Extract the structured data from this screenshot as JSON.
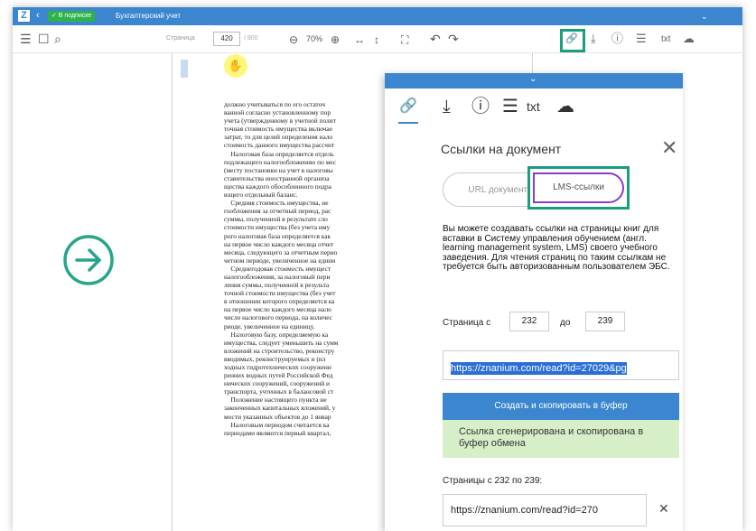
{
  "colors": {
    "brand_blue": "#3b86cf",
    "badge_green": "#2fb24c",
    "highlight_teal": "#1a9e7f",
    "lms_tab_border": "#8a3cc8",
    "success_bg": "#d7efc9",
    "selection_blue": "#2b6fd6"
  },
  "titlebar": {
    "logo": "Z",
    "back_icon": "chevron-left-icon",
    "badge": "✓ В подписке",
    "title": "Бухгалтерский учет",
    "menu_icon": "chevron-down-icon"
  },
  "toolbar": {
    "menu_icon": "☰",
    "bookmark_icon": "☐",
    "search_icon": "⌕",
    "page_label": "Страница",
    "page_value": "420",
    "page_total": "/ 900",
    "zoom_out": "⊖",
    "zoom_value": "70%",
    "zoom_in": "⊕",
    "fit_width": "↔",
    "fit_height": "↕",
    "fullscreen": "⛶",
    "undo": "↶",
    "redo": "↷",
    "link_icon": "🔗",
    "download_icon": "⤓",
    "info_icon": "ⓘ",
    "print_icon": "☰",
    "txt_label": "txt",
    "cloud_icon": "☁"
  },
  "document": {
    "lines": [
      "должно учитываться по его остаточ",
      "ванной согласно установленному пор",
      "учета (утвержденному в учетной полит",
      "точная стоимость имущества включае",
      "затрат, то для целей определения нало",
      "стоимость данного имущества рассчит",
      "    Налоговая база определяется отдель",
      "подлежащего налогообложению по мес",
      "(месту постановки на учет в налоговы",
      "ставительства иностранной организа",
      "щества каждого обособленного подра",
      "ющего отдельный баланс.",
      "    Средняя стоимость имущества, не",
      "гообложения за отчетный период, рас",
      "суммы, полученной в результате сло",
      "стоимости имущества (без учета иму",
      "рого налоговая база определяется как",
      "на первое число каждого месяца отчет",
      "месяца, следующего за отчетным перио",
      "четном периоде, увеличенное на едини",
      "    Среднегодовая стоимость имущест",
      "налогообложения, за налоговый пери",
      "ления суммы, полученной в результа",
      "точной стоимости имущества (без учет",
      "в отношении которого определяется ка",
      "на первое число каждого месяца нало",
      "число налогового периода, на количес",
      "риоде, увеличенное на единицу.",
      "    Налоговую базу, определяемую ка",
      "имущества, следует уменьшить на сумм",
      "вложений на строительство, реконстру",
      "вводимых, реконструируемых и (ил",
      "ходных гидротехнических сооружени",
      "ренних водных путей Российской Фед",
      "нических сооружений, сооружений и",
      "транспорта, учтенных в балансовой ст",
      "    Положение настоящего пункта не",
      "законченных капитальных вложений, у",
      "мости указанных объектов до 1 январ",
      "    Налоговым периодом считается ка",
      "периодами являются первый квартал,"
    ]
  },
  "panel": {
    "collapse_icon": "⌄",
    "icons": [
      "🔗",
      "⤓",
      "ⓘ",
      "☰"
    ],
    "txt_label": "txt",
    "cloud_icon": "☁",
    "title": "Ссылки на документ",
    "close_icon": "✕",
    "tab_url": "URL документа",
    "tab_lms": "LMS-ссылки",
    "description": "Вы можете создавать ссылки на страницы книг для вставки в Систему управления обучением (англ. learning management system, LMS) своего учебного заведения. Для чтения страниц по таким ссылкам не требуется быть авторизованным пользователем ЭБС.",
    "range_label": "Страница с",
    "range_from": "232",
    "range_to_label": "до",
    "range_to": "239",
    "url_value": "https://znanium.com/read?id=27029&pg",
    "create_button": "Создать и скопировать в буфер",
    "success_message": "Ссылка сгенерирована и скопирована в буфер обмена",
    "pages_label": "Страницы с 232 по 239:",
    "result_value": "https://znanium.com/read?id=270",
    "result_clear": "✕"
  }
}
